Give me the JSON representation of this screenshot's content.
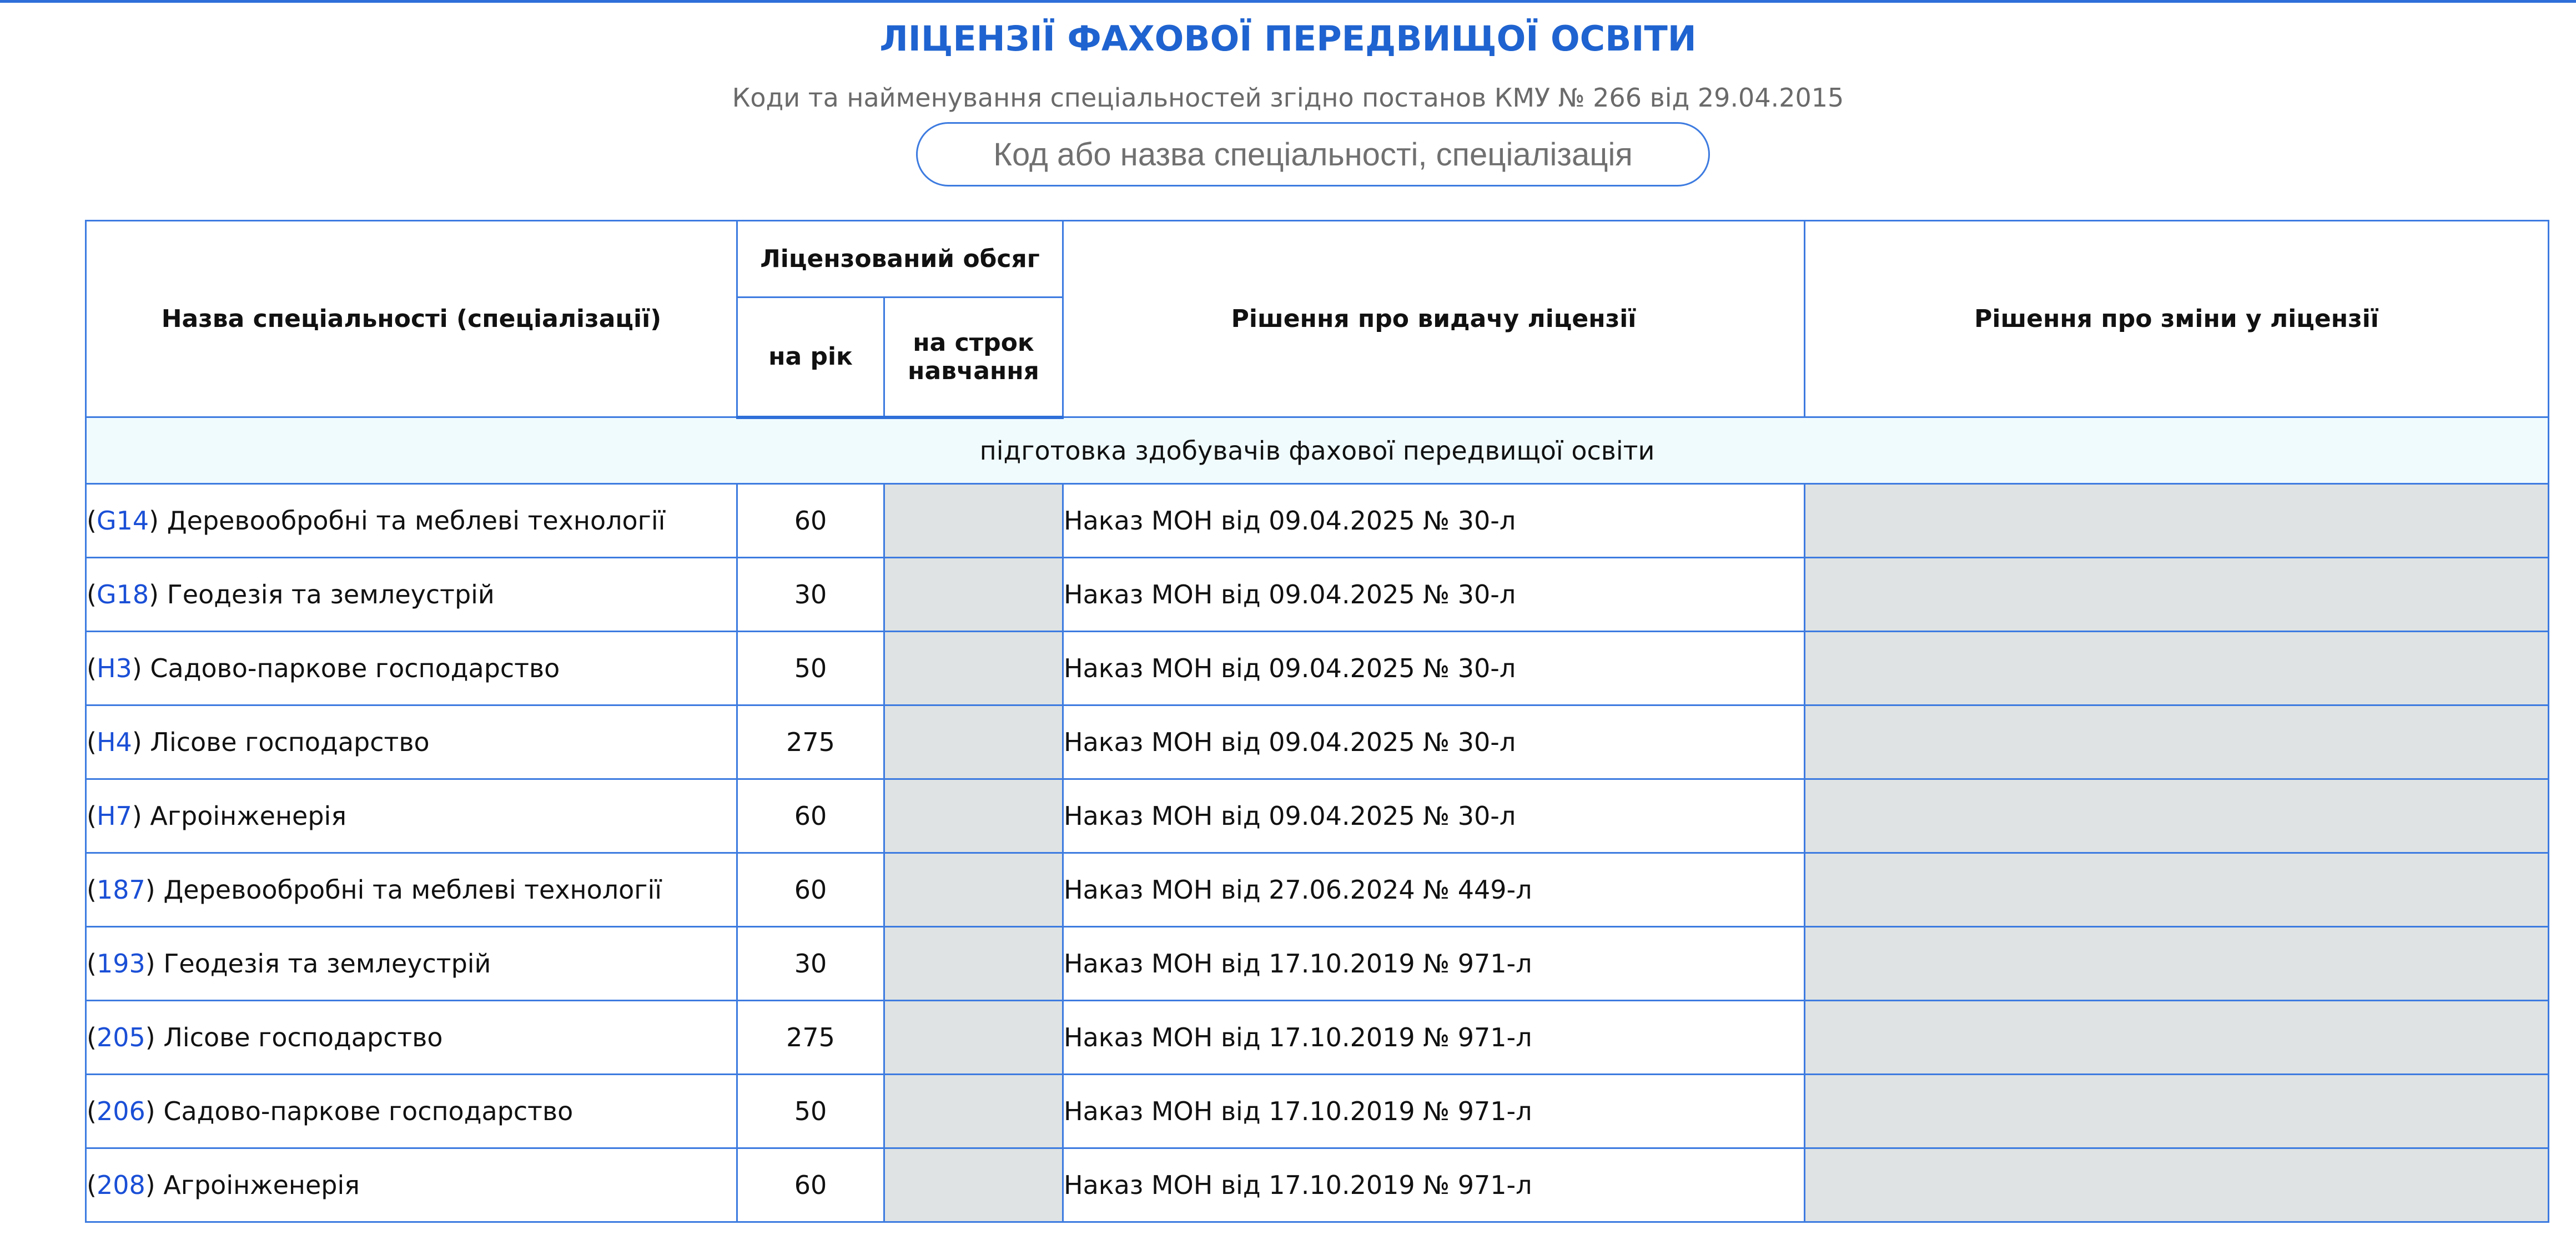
{
  "page": {
    "title": "ЛІЦЕНЗІЇ ФАХОВОЇ ПЕРЕДВИЩОЇ ОСВІТИ",
    "subtitle": "Коди та найменування спеціальностей згідно постанов КМУ № 266 від 29.04.2015",
    "search_placeholder": "Код або назва спеціальності, спеціалізація"
  },
  "colors": {
    "accent": "#2e6fd9",
    "link": "#1a4fd6",
    "group_bg": "#f0fbfe",
    "empty_cell_bg": "#dfe3e3"
  },
  "table": {
    "headers": {
      "name": "Назва спеціальності (спеціалізації)",
      "volume": "Ліцензований обсяг",
      "per_year": "на рік",
      "per_term": "на строк навчання",
      "decision_issue": "Рішення про видачу ліцензії",
      "decision_change": "Рішення про зміни у ліцензії"
    },
    "group": "підготовка здобувачів фахової передвищої освіти",
    "rows": [
      {
        "code": "G14",
        "name": "Деревообробні та меблеві технології",
        "per_year": "60",
        "per_term": "",
        "decision": "Наказ МОН від 09.04.2025 № 30-л",
        "change": ""
      },
      {
        "code": "G18",
        "name": "Геодезія та землеустрій",
        "per_year": "30",
        "per_term": "",
        "decision": "Наказ МОН від 09.04.2025 № 30-л",
        "change": ""
      },
      {
        "code": "H3",
        "name": "Садово-паркове господарство",
        "per_year": "50",
        "per_term": "",
        "decision": "Наказ МОН від 09.04.2025 № 30-л",
        "change": ""
      },
      {
        "code": "H4",
        "name": "Лісове господарство",
        "per_year": "275",
        "per_term": "",
        "decision": "Наказ МОН від 09.04.2025 № 30-л",
        "change": ""
      },
      {
        "code": "H7",
        "name": "Агроінженерія",
        "per_year": "60",
        "per_term": "",
        "decision": "Наказ МОН від 09.04.2025 № 30-л",
        "change": ""
      },
      {
        "code": "187",
        "name": "Деревообробні та меблеві технології",
        "per_year": "60",
        "per_term": "",
        "decision": "Наказ МОН від 27.06.2024 № 449-л",
        "change": ""
      },
      {
        "code": "193",
        "name": "Геодезія та землеустрій",
        "per_year": "30",
        "per_term": "",
        "decision": "Наказ МОН від 17.10.2019 № 971-л",
        "change": ""
      },
      {
        "code": "205",
        "name": "Лісове господарство",
        "per_year": "275",
        "per_term": "",
        "decision": "Наказ МОН від 17.10.2019 № 971-л",
        "change": ""
      },
      {
        "code": "206",
        "name": "Садово-паркове господарство",
        "per_year": "50",
        "per_term": "",
        "decision": "Наказ МОН від 17.10.2019 № 971-л",
        "change": ""
      },
      {
        "code": "208",
        "name": "Агроінженерія",
        "per_year": "60",
        "per_term": "",
        "decision": "Наказ МОН від 17.10.2019 № 971-л",
        "change": ""
      }
    ]
  }
}
